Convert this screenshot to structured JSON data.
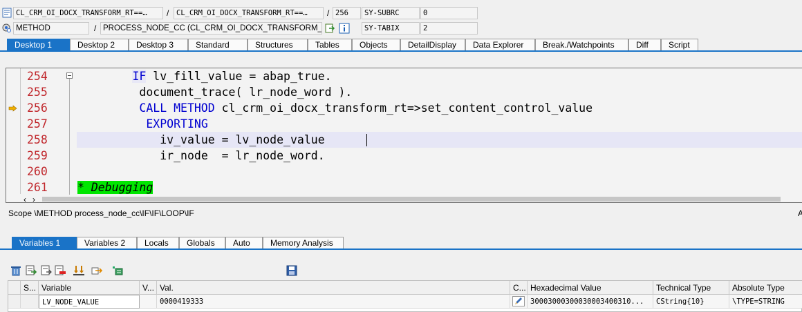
{
  "top": {
    "row1": {
      "class_field": "CL_CRM_OI_DOCX_TRANSFORM_RT==…",
      "class_field2": "CL_CRM_OI_DOCX_TRANSFORM_RT==…",
      "line_no": "256",
      "sysvar_name": "SY-SUBRC",
      "sysvar_value": "0",
      "sep1": "/",
      "sep2": "/"
    },
    "row2": {
      "kind_field": "METHOD",
      "proc_field": "PROCESS_NODE_CC (CL_CRM_OI_DOCX_TRANSFORM_…",
      "sysvar_name": "SY-TABIX",
      "sysvar_value": "2",
      "sep1": "/"
    }
  },
  "desktop_tabs": [
    "Desktop 1",
    "Desktop 2",
    "Desktop 3",
    "Standard",
    "Structures",
    "Tables",
    "Objects",
    "DetailDisplay",
    "Data Explorer",
    "Break./Watchpoints",
    "Diff",
    "Script"
  ],
  "code": {
    "lines": [
      {
        "num": "254",
        "indent": "        ",
        "parts": [
          {
            "t": "IF",
            "c": "kw hl"
          },
          {
            "t": " lv_fill_value = abap_true.",
            "c": ""
          }
        ]
      },
      {
        "num": "255",
        "indent": "         ",
        "parts": [
          {
            "t": "document_trace( lr_node_word ).",
            "c": ""
          }
        ]
      },
      {
        "num": "256",
        "indent": "         ",
        "parts": [
          {
            "t": "CALL METHOD",
            "c": "kw"
          },
          {
            "t": " cl_crm_oi_docx_transform_rt=>set_content_control_value",
            "c": ""
          }
        ]
      },
      {
        "num": "257",
        "indent": "          ",
        "parts": [
          {
            "t": "EXPORTING",
            "c": "kw"
          }
        ]
      },
      {
        "num": "258",
        "indent": "            ",
        "parts": [
          {
            "t": "iv_value = lv_node_value",
            "c": ""
          }
        ]
      },
      {
        "num": "259",
        "indent": "            ",
        "parts": [
          {
            "t": "ir_node  = lr_node_word.",
            "c": ""
          }
        ]
      },
      {
        "num": "260",
        "indent": "",
        "parts": []
      },
      {
        "num": "261",
        "indent": "",
        "parts": [
          {
            "t": "* Debugging",
            "c": "comment"
          }
        ]
      }
    ]
  },
  "scope": "Scope \\METHOD process_node_cc\\IF\\IF\\LOOP\\IF",
  "scope_right": "A",
  "var_tabs": [
    "Variables 1",
    "Variables 2",
    "Locals",
    "Globals",
    "Auto",
    "Memory Analysis"
  ],
  "table": {
    "headers": [
      "S...",
      "Variable",
      "V...",
      "Val.",
      "C...",
      "Hexadecimal Value",
      "Technical Type",
      "Absolute Type"
    ],
    "rows": [
      {
        "s": "",
        "variable": "LV_NODE_VALUE",
        "v": "",
        "val": "0000419333",
        "c": "pencil-icon",
        "hex": "30003000300030003400310...",
        "tech": "CString{10}",
        "abs": "\\TYPE=STRING"
      }
    ]
  },
  "colors": {
    "accent": "#1a73c7",
    "keyword": "#0000d0",
    "line_number": "#c0262b",
    "comment_bg": "#00e600"
  }
}
